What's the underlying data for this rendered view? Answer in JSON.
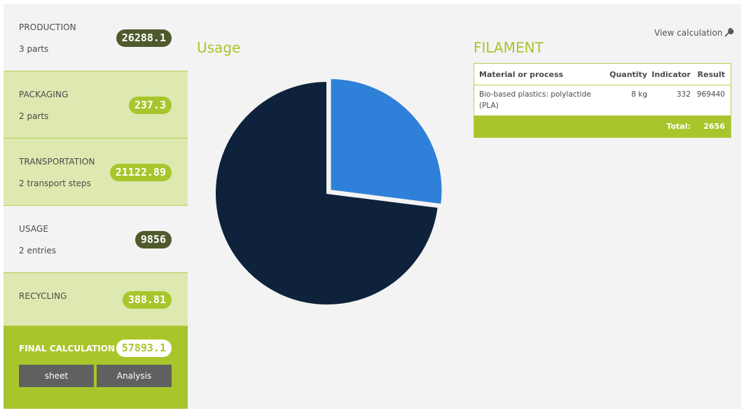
{
  "sidebar": {
    "steps": [
      {
        "title": "PRODUCTION",
        "subtitle": "3 parts",
        "value": "26288.1"
      },
      {
        "title": "PACKAGING",
        "subtitle": "2 parts",
        "value": "237.3"
      },
      {
        "title": "TRANSPORTATION",
        "subtitle": "2 transport steps",
        "value": "21122.89"
      },
      {
        "title": "USAGE",
        "subtitle": "2 entries",
        "value": "9856"
      },
      {
        "title": "RECYCLING",
        "subtitle": "",
        "value": "388.81"
      }
    ],
    "final": {
      "title": "FINAL CALCULATION",
      "value": "57893.1",
      "buttons": {
        "sheet": "sheet",
        "analysis": "Analysis"
      }
    }
  },
  "usage": {
    "title": "Usage"
  },
  "chart_data": {
    "type": "pie",
    "title": "Usage",
    "slices": [
      {
        "value": 27,
        "color": "#2f80d8",
        "exploded": true
      },
      {
        "value": 73,
        "color": "#0e223b",
        "exploded": false
      }
    ]
  },
  "filament": {
    "view_calculation": "View calculation",
    "view_icon": "wrench-icon",
    "title": "FILAMENT",
    "table": {
      "headers": {
        "material": "Material or process",
        "quantity": "Quantity",
        "indicator": "Indicator",
        "result": "Result"
      },
      "rows": [
        {
          "material": "Bio-based plastics: polylactide (PLA)",
          "quantity": "8 kg",
          "indicator": "332",
          "result": "969440"
        }
      ],
      "total_label": "Total:",
      "total_value": "2656"
    }
  },
  "colors": {
    "accent": "#a9c52c",
    "dark_badge": "#4f5a2c",
    "light_step": "#dde9b0"
  }
}
